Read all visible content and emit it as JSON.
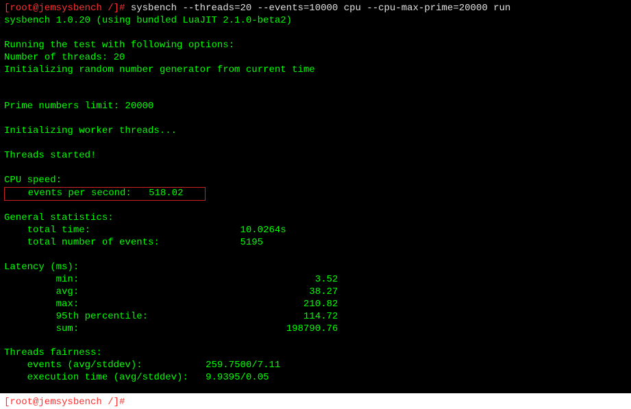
{
  "prompt": {
    "user_host": "[root@jemsysbench /]#",
    "command": "sysbench --threads=20 --events=10000 cpu --cpu-max-prime=20000 run"
  },
  "version_line": "sysbench 1.0.20 (using bundled LuaJIT 2.1.0-beta2)",
  "options_header": "Running the test with following options:",
  "threads_line": "Number of threads: 20",
  "rng_line": "Initializing random number generator from current time",
  "prime_line": "Prime numbers limit: 20000",
  "init_workers": "Initializing worker threads...",
  "threads_started": "Threads started!",
  "cpu_speed_header": "CPU speed:",
  "events_per_second": {
    "label": "events per second:",
    "value": "518.02"
  },
  "general_stats": {
    "header": "General statistics:",
    "total_time": {
      "label": "total time:",
      "value": "10.0264s"
    },
    "total_events": {
      "label": "total number of events:",
      "value": "5195"
    }
  },
  "latency": {
    "header": "Latency (ms):",
    "min": {
      "label": "min:",
      "value": "3.52"
    },
    "avg": {
      "label": "avg:",
      "value": "38.27"
    },
    "max": {
      "label": "max:",
      "value": "210.82"
    },
    "p95": {
      "label": "95th percentile:",
      "value": "114.72"
    },
    "sum": {
      "label": "sum:",
      "value": "198790.76"
    }
  },
  "fairness": {
    "header": "Threads fairness:",
    "events": {
      "label": "events (avg/stddev):",
      "value": "259.7500/7.11"
    },
    "exec_time": {
      "label": "execution time (avg/stddev):",
      "value": "9.9395/0.05"
    }
  },
  "trailing_prompt": "[root@jemsysbench /]#"
}
